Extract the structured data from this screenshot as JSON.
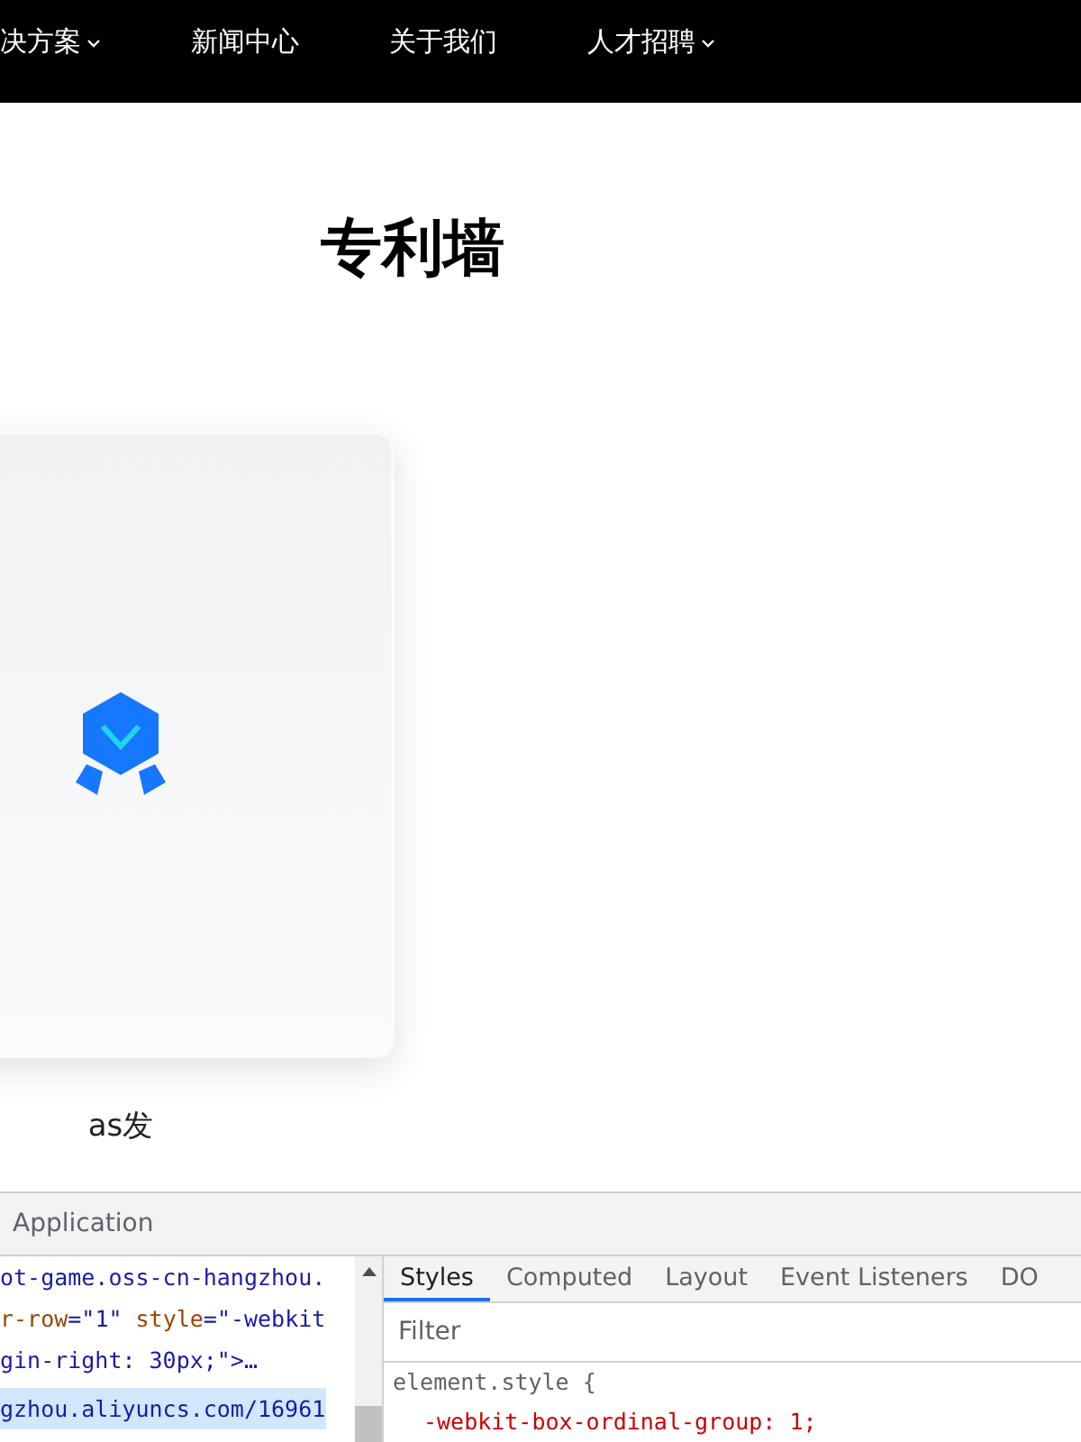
{
  "nav": {
    "items": [
      {
        "label": "决方案",
        "dropdown": true
      },
      {
        "label": "新闻中心",
        "dropdown": false
      },
      {
        "label": "关于我们",
        "dropdown": false
      },
      {
        "label": "人才招聘",
        "dropdown": true
      }
    ]
  },
  "page": {
    "title": "专利墙",
    "cards": [
      {
        "caption": "as发"
      }
    ]
  },
  "devtools": {
    "panel_tab": "Application",
    "elements": [
      {
        "selected": false,
        "tokens": [
          {
            "kind": "value",
            "text": "ot-game.oss-cn-hangzhou."
          }
        ]
      },
      {
        "selected": false,
        "tokens": [
          {
            "kind": "attr",
            "text": "r-row"
          },
          {
            "kind": "value",
            "text": "=\"1\" "
          },
          {
            "kind": "attr",
            "text": "style"
          },
          {
            "kind": "value",
            "text": "=\"-webkit"
          }
        ]
      },
      {
        "selected": false,
        "tokens": [
          {
            "kind": "value",
            "text": "gin-right: 30px;\">…"
          }
        ]
      },
      {
        "selected": true,
        "tokens": [
          {
            "kind": "value",
            "text": "gzhou.aliyuncs.com/16961"
          }
        ]
      }
    ],
    "tabs": [
      {
        "label": "Styles",
        "selected": true
      },
      {
        "label": "Computed",
        "selected": false
      },
      {
        "label": "Layout",
        "selected": false
      },
      {
        "label": "Event Listeners",
        "selected": false
      },
      {
        "label": "DO",
        "selected": false
      }
    ],
    "filter": {
      "placeholder": "Filter"
    },
    "rules": [
      {
        "kind": "selector",
        "text": "element.style {"
      },
      {
        "kind": "declaration",
        "text": "-webkit-box-ordinal-group: 1;"
      }
    ]
  }
}
